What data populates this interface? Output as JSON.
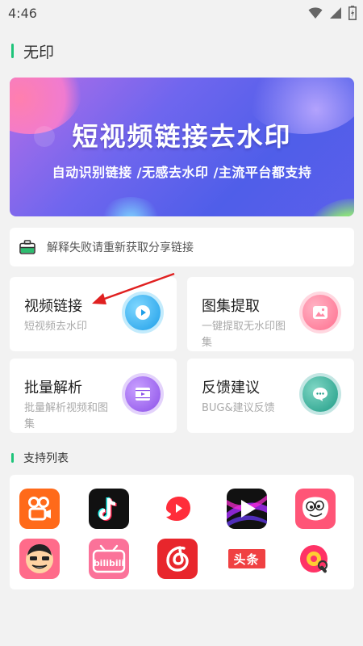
{
  "status_bar": {
    "time": "4:46"
  },
  "app_title": "无印",
  "banner": {
    "title": "短视频链接去水印",
    "subtitle": "自动识别链接 /无感去水印 /主流平台都支持"
  },
  "notice": {
    "text": "解释失败请重新获取分享链接",
    "icon": "briefcase-icon"
  },
  "features": [
    {
      "title": "视频链接",
      "desc": "短视频去水印",
      "icon": "play-video-icon",
      "color": "#29b6f6"
    },
    {
      "title": "图集提取",
      "desc": "一键提取无水印图集",
      "icon": "image-gallery-icon",
      "color": "#ff6f91"
    },
    {
      "title": "批量解析",
      "desc": "批量解析视频和图集",
      "icon": "film-icon",
      "color": "#9c5cf0"
    },
    {
      "title": "反馈建议",
      "desc": "BUG&建议反馈",
      "icon": "chat-bubble-icon",
      "color": "#26a69a"
    }
  ],
  "support_section": {
    "title": "支持列表"
  },
  "platforms": [
    {
      "icon": "kuaishou-logo",
      "color": "#ff6a1a"
    },
    {
      "icon": "douyin-logo",
      "color": "#111111"
    },
    {
      "icon": "weishi-logo",
      "color": "#ff3b3b"
    },
    {
      "icon": "xigua-video-logo",
      "color": "#111111"
    },
    {
      "icon": "pipixia-logo",
      "color": "#ff5577"
    },
    {
      "icon": "zuiyou-logo",
      "color": "#ff6b8a"
    },
    {
      "icon": "bilibili-logo",
      "color": "#fb7299"
    },
    {
      "icon": "netease-cloud-music-logo",
      "color": "#e8262c"
    },
    {
      "icon": "toutiao-logo",
      "color": "#ffffff",
      "label": "头条"
    },
    {
      "icon": "pipigaoxiao-logo",
      "color": "#ff3366"
    }
  ]
}
